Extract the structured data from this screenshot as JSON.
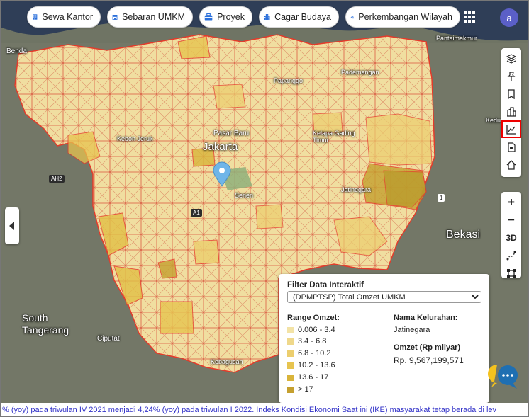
{
  "nav": [
    {
      "label": "Sewa Kantor",
      "icon": "building-icon"
    },
    {
      "label": "Sebaran UMKM",
      "icon": "store-icon"
    },
    {
      "label": "Proyek",
      "icon": "briefcase-icon"
    },
    {
      "label": "Cagar Budaya",
      "icon": "heritage-building-icon"
    },
    {
      "label": "Perkembangan Wilayah",
      "icon": "trend-chart-icon"
    }
  ],
  "user": {
    "initial": "a"
  },
  "map": {
    "labels": [
      "Benda",
      "Jakarta",
      "Pasar Baru",
      "Kebon Jeruk",
      "Senen",
      "Pademangan",
      "Kelapa Gading Timur",
      "Pantaimakmur",
      "Jatinegara",
      "Bekasi",
      "South Tangerang",
      "Ciputat",
      "Kedu",
      "Kebagusan",
      "Papanggo"
    ],
    "roads": [
      "AH2",
      "A1",
      "1"
    ],
    "colors": {
      "border": "#e53a2a",
      "class1": "#f3e3a6",
      "class2": "#efd88b",
      "class3": "#ecce6e",
      "class4": "#e7c44f",
      "class5": "#d9b43a",
      "class6": "#c5a02f",
      "marker": "#6fb5e8"
    }
  },
  "tools": [
    "layers-icon",
    "pin-icon",
    "bookmark-icon",
    "buildings-icon",
    "chart-line-icon",
    "document-icon",
    "home-icon"
  ],
  "zoom": {
    "in": "+",
    "out": "−",
    "mode": "3D"
  },
  "panel": {
    "title": "Filter Data Interaktif",
    "selected": "(DPMPTSP) Total Omzet UMKM",
    "range_header": "Range Omzet:",
    "ranges": [
      {
        "label": "0.006 - 3.4",
        "color": "#f3e3a6"
      },
      {
        "label": "3.4 - 6.8",
        "color": "#efd88b"
      },
      {
        "label": "6.8 - 10.2",
        "color": "#ecce6e"
      },
      {
        "label": "10.2 - 13.6",
        "color": "#e7c44f"
      },
      {
        "label": "13.6 - 17",
        "color": "#d9b43a"
      },
      {
        "label": "> 17",
        "color": "#c5a02f"
      }
    ],
    "kel_header": "Nama Kelurahan:",
    "kel_value": "Jatinegara",
    "omzet_header": "Omzet (Rp milyar)",
    "omzet_value": "Rp. 9,567,199,571"
  },
  "ticker": "% (yoy) pada triwulan IV 2021 menjadi 4,24% (yoy) pada triwulan I 2022. Indeks Kondisi Ekonomi Saat ini (IKE) masyarakat tetap berada di lev"
}
